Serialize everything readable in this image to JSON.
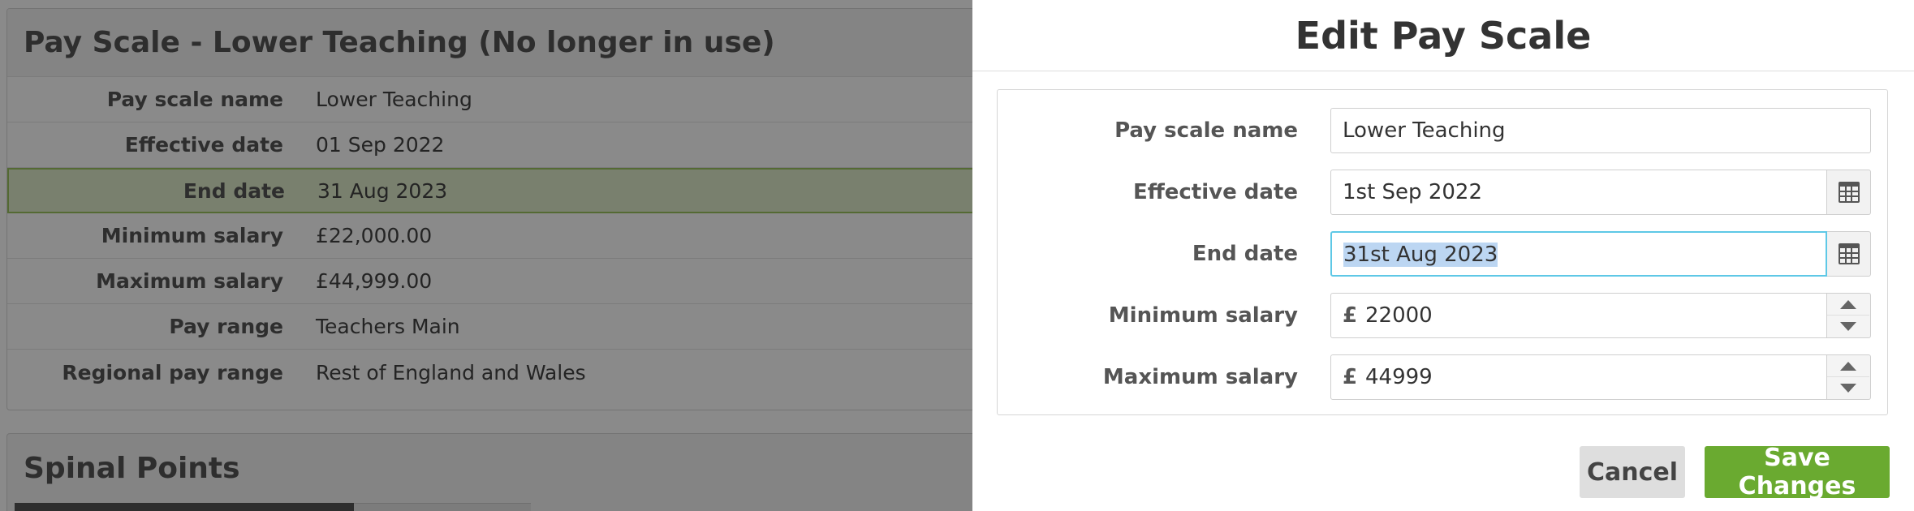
{
  "background": {
    "panel_title": "Pay Scale - Lower Teaching (No longer in use)",
    "details": [
      {
        "label": "Pay scale name",
        "value": "Lower Teaching"
      },
      {
        "label": "Effective date",
        "value": "01 Sep 2022"
      },
      {
        "label": "End date",
        "value": "31 Aug 2023"
      },
      {
        "label": "Minimum salary",
        "value": "£22,000.00"
      },
      {
        "label": "Maximum salary",
        "value": "£44,999.00"
      },
      {
        "label": "Pay range",
        "value": "Teachers Main"
      },
      {
        "label": "Regional pay range",
        "value": "Rest of England and Wales"
      }
    ],
    "spinal_points_title": "Spinal Points"
  },
  "modal": {
    "title": "Edit Pay Scale",
    "fields": {
      "pay_scale_name": {
        "label": "Pay scale name",
        "value": "Lower Teaching"
      },
      "effective_date": {
        "label": "Effective date",
        "value": "1st Sep 2022",
        "icon": "calendar-icon"
      },
      "end_date": {
        "label": "End date",
        "value": "31st Aug 2023",
        "icon": "calendar-icon"
      },
      "minimum_salary": {
        "label": "Minimum salary",
        "currency": "£",
        "value": "22000"
      },
      "maximum_salary": {
        "label": "Maximum salary",
        "currency": "£",
        "value": "44999"
      }
    },
    "buttons": {
      "cancel": "Cancel",
      "save": "Save Changes"
    }
  },
  "colors": {
    "save_button": "#6aaa30",
    "focus_border": "#5ec8e6",
    "selection": "#bcd6f2",
    "highlight_row": "#dfeccc"
  }
}
